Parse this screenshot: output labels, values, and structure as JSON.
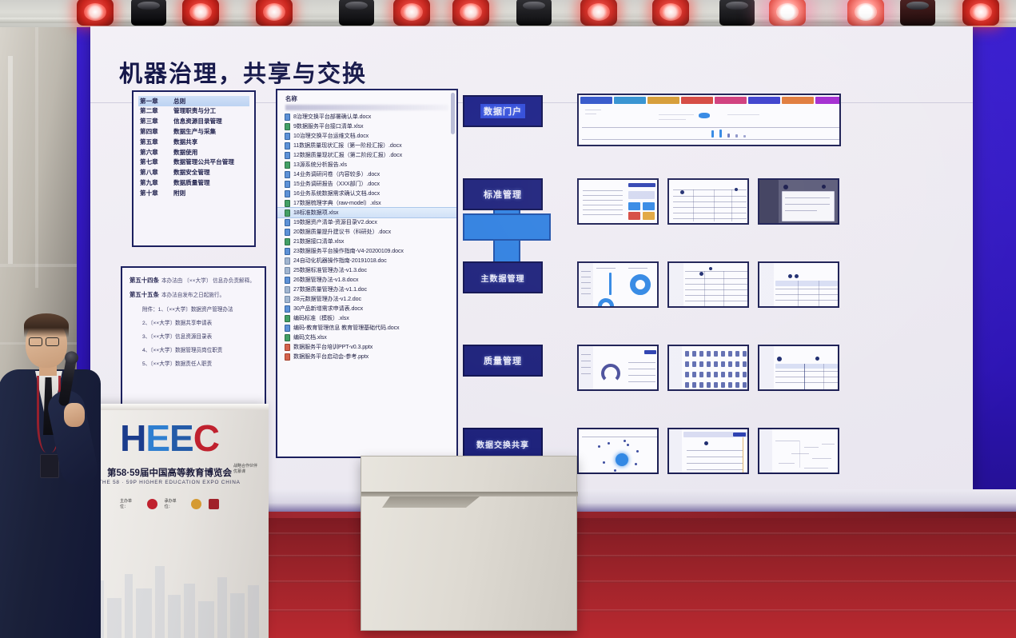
{
  "scene": {
    "venue_name": "HEEC",
    "stage_lights": [
      {
        "type": "par-light",
        "state": "red"
      },
      {
        "type": "moving-head-light",
        "state": "off"
      },
      {
        "type": "par-light",
        "state": "red"
      },
      {
        "type": "par-light",
        "state": "red"
      },
      {
        "type": "moving-head-light",
        "state": "off"
      },
      {
        "type": "par-light",
        "state": "red"
      },
      {
        "type": "par-light",
        "state": "red"
      },
      {
        "type": "moving-head-light",
        "state": "off"
      },
      {
        "type": "par-light",
        "state": "red"
      },
      {
        "type": "par-light",
        "state": "red"
      },
      {
        "type": "moving-head-light",
        "state": "off"
      },
      {
        "type": "par-light",
        "state": "white-hot"
      },
      {
        "type": "par-light",
        "state": "white-hot"
      },
      {
        "type": "moving-head-light",
        "state": "warm"
      },
      {
        "type": "par-light",
        "state": "red"
      }
    ]
  },
  "podium": {
    "logo_text": "HEEC",
    "logo_letters": [
      "H",
      "E",
      "E",
      "C"
    ],
    "title_cn": "第58·59届中国高等教育博览会",
    "title_en": "THE 58 · 59P HIGHER EDUCATION EXPO CHINA",
    "partner_label": "战略合作伙伴",
    "partner_name": "优慕课",
    "org_host_label": "主办单位：",
    "org_co_label": "承办单位：",
    "colors": {
      "blue_dark": "#1b3c8c",
      "blue_light": "#2f7fd0",
      "red": "#c0212e"
    }
  },
  "presenter": {
    "description": "speaker-at-podium",
    "holding": "microphone"
  },
  "slide": {
    "title": "机器治理，共享与交换",
    "plus_symbol": "+",
    "chapters": {
      "selected_index": 0,
      "items": [
        {
          "no": "第一章",
          "name": "总则"
        },
        {
          "no": "第二章",
          "name": "管理职责与分工"
        },
        {
          "no": "第三章",
          "name": "信息资源目录管理"
        },
        {
          "no": "第四章",
          "name": "数据生产与采集"
        },
        {
          "no": "第五章",
          "name": "数据共享"
        },
        {
          "no": "第六章",
          "name": "数据使用"
        },
        {
          "no": "第七章",
          "name": "数据管理公共平台管理"
        },
        {
          "no": "第八章",
          "name": "数据安全管理"
        },
        {
          "no": "第九章",
          "name": "数据质量管理"
        },
        {
          "no": "第十章",
          "name": "附则"
        }
      ]
    },
    "regulation_doc": {
      "headings": [
        {
          "no": "第五十四条",
          "body": "本办法由 〔××大学〕 信息办负责解释。"
        },
        {
          "no": "第五十五条",
          "body": "本办法自发布之日起施行。"
        }
      ],
      "list_label": "附件：",
      "list_items": [
        "1、〔××大学〕数据资产管理办法",
        "2、〔××大学〕数据共享申请表",
        "3、〔××大学〕信息资源目录表",
        "4、〔××大学〕数据管理员岗位职责",
        "5、〔××大学〕数据责任人职责"
      ]
    },
    "file_explorer": {
      "column_header": "名称",
      "selected_file": "18标准数据项.xlsx",
      "files": [
        {
          "name": "8治理交换平台部署确认单.docx",
          "type": "docx"
        },
        {
          "name": "9数据服务平台接口清单.xlsx",
          "type": "xlsx"
        },
        {
          "name": "10治理交换平台运维文档.docx",
          "type": "docx"
        },
        {
          "name": "11数据质量现状汇报（第一阶段汇报）.docx",
          "type": "docx"
        },
        {
          "name": "12数据质量现状汇报（第二阶段汇报）.docx",
          "type": "docx"
        },
        {
          "name": "13源系统分析报告.xls",
          "type": "xlsx"
        },
        {
          "name": "14业务调研问卷（内容较多）.docx",
          "type": "docx"
        },
        {
          "name": "15业务调研报告（XXX部门）.docx",
          "type": "docx"
        },
        {
          "name": "16业务系统数据需求确认文档.docx",
          "type": "docx"
        },
        {
          "name": "17数据梳理字典（raw-model）.xlsx",
          "type": "xlsx"
        },
        {
          "name": "18标准数据项.xlsx",
          "type": "xlsx"
        },
        {
          "name": "19数据资产清单-资源目录V2.docx",
          "type": "docx"
        },
        {
          "name": "20数据质量提升建议书（科研处）.docx",
          "type": "docx"
        },
        {
          "name": "21数据接口清单.xlsx",
          "type": "xlsx"
        },
        {
          "name": "23数据服务平台操作指南-V4-20200109.docx",
          "type": "docx"
        },
        {
          "name": "24自动化机器操作指南-20191018.doc",
          "type": "doc"
        },
        {
          "name": "25数据标准管理办法-v1.3.doc",
          "type": "doc"
        },
        {
          "name": "26数据管理办法-v1.8.docx",
          "type": "docx"
        },
        {
          "name": "27数据质量管理办法-v1.1.doc",
          "type": "doc"
        },
        {
          "name": "28元数据管理办法-v1.2.doc",
          "type": "doc"
        },
        {
          "name": "30产品新增需求申请表.docx",
          "type": "docx"
        },
        {
          "name": "编码标准（模板）.xlsx",
          "type": "xlsx"
        },
        {
          "name": "编码-教育管理信息 教育管理基础代码.docx",
          "type": "docx"
        },
        {
          "name": "编码文档.xlsx",
          "type": "xlsx"
        },
        {
          "name": "数据服务平台培训PPT-v0.3.pptx",
          "type": "pptx"
        },
        {
          "name": "数据服务平台启动会-参考.pptx",
          "type": "pptx"
        }
      ]
    },
    "modules": [
      {
        "label": "数据门户",
        "highlighted": true
      },
      {
        "label": "标准管理",
        "highlighted": false
      },
      {
        "label": "主数据管理",
        "highlighted": false
      },
      {
        "label": "质量管理",
        "highlighted": false
      },
      {
        "label": "数据交换共享",
        "highlighted": false
      }
    ],
    "screenshot_rows": [
      {
        "module": "数据门户",
        "thumbs": [
          "portal-dashboard-wide"
        ]
      },
      {
        "module": "标准管理",
        "thumbs": [
          "standard-overview",
          "standard-table",
          "standard-modal"
        ]
      },
      {
        "module": "主数据管理",
        "thumbs": [
          "master-donut-chart",
          "master-list",
          "master-detail-table"
        ]
      },
      {
        "module": "质量管理",
        "thumbs": [
          "quality-gauge",
          "quality-icon-grid",
          "quality-report-table"
        ]
      },
      {
        "module": "数据交换共享",
        "thumbs": [
          "exchange-network-graph",
          "exchange-config-form",
          "exchange-flow-tree"
        ]
      }
    ],
    "colors": {
      "title": "#16184a",
      "module_button": "#1b1f7a",
      "accent_blue": "#2e7fe0",
      "slide_bg": "#f0edf4"
    }
  }
}
